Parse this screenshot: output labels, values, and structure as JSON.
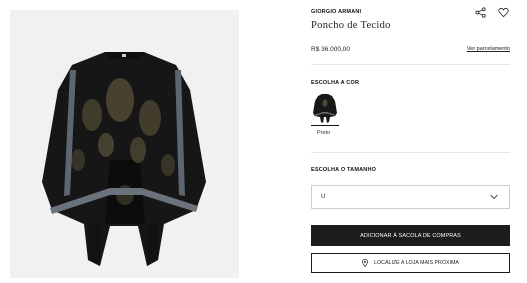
{
  "product": {
    "brand": "GIORGIO ARMANI",
    "title": "Poncho de Tecido",
    "price": "R$ 36.000,00",
    "installments_link": "Ver parcelamento"
  },
  "color": {
    "section_label": "ESCOLHA A COR",
    "options": [
      {
        "name": "Preto",
        "selected": true,
        "swatch_color": "#1a1a1a"
      }
    ]
  },
  "size": {
    "section_label": "ESCOLHA O TAMANHO",
    "selected": "U"
  },
  "actions": {
    "add_to_bag": "ADICIONAR À SACOLA DE COMPRAS",
    "find_store": "LOCALIZE A LOJA MAIS PRÓXIMA"
  },
  "icons": {
    "share": "share-icon",
    "wishlist": "heart-icon",
    "dropdown": "chevron-down-icon",
    "store": "map-pin-icon"
  },
  "colors": {
    "primary_button": "#1c1c1c",
    "image_background": "#f1f1f1",
    "garment_main": "#161616",
    "garment_trim": "#5d6670",
    "garment_pattern": "#5a523a"
  }
}
